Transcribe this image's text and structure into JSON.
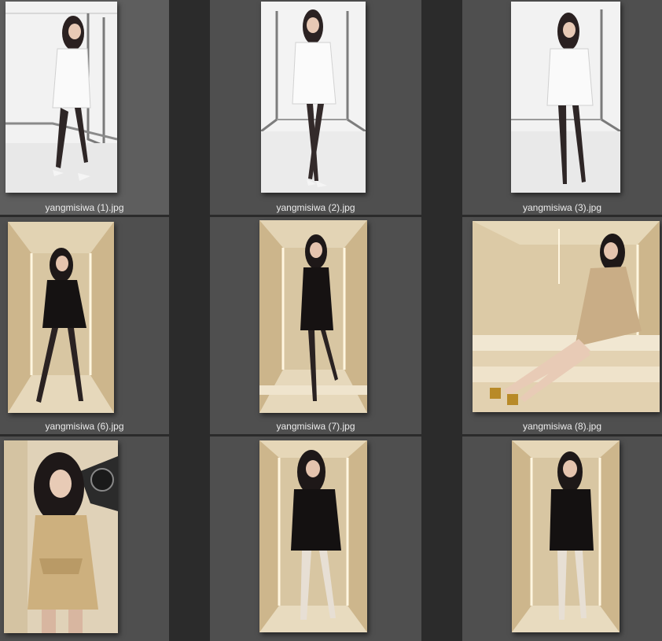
{
  "watermark": "",
  "items": [
    {
      "filename": "yangmisiwa (1).jpg",
      "scene": "white-room",
      "outfit": "white-blazer",
      "selected": true
    },
    {
      "filename": "yangmisiwa (2).jpg",
      "scene": "white-room",
      "outfit": "white-blazer",
      "selected": false
    },
    {
      "filename": "yangmisiwa (3).jpg",
      "scene": "white-room",
      "outfit": "white-blazer",
      "selected": false
    },
    {
      "filename": "yangmisiwa (6).jpg",
      "scene": "beige-lightbox",
      "outfit": "black-dress",
      "selected": false
    },
    {
      "filename": "yangmisiwa (7).jpg",
      "scene": "beige-lightbox",
      "outfit": "black-dress",
      "selected": false
    },
    {
      "filename": "yangmisiwa (8).jpg",
      "scene": "beige-lightbox",
      "outfit": "gold-dress-seated",
      "selected": false
    },
    {
      "filename": "",
      "scene": "beige-studio",
      "outfit": "gold-dress",
      "selected": false
    },
    {
      "filename": "",
      "scene": "beige-lightbox",
      "outfit": "black-coat",
      "selected": false
    },
    {
      "filename": "",
      "scene": "beige-lightbox",
      "outfit": "black-coat",
      "selected": false
    }
  ],
  "colors": {
    "cell_bg": "#4f4f4f",
    "cell_selected_bg": "#5e5e5e",
    "gutter": "#2b2b2b",
    "caption": "#ececec"
  }
}
